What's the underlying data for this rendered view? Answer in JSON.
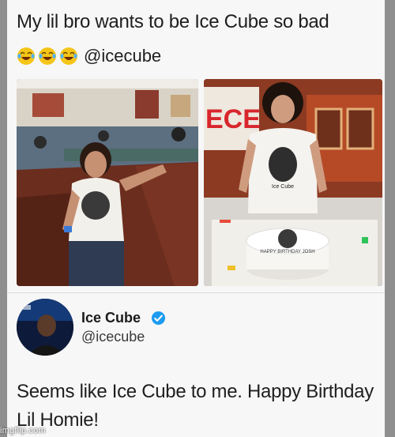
{
  "post": {
    "text": "My lil bro wants to be Ice Cube so bad",
    "emoji": [
      "laughing-crying-emoji",
      "laughing-crying-emoji",
      "laughing-crying-emoji"
    ],
    "mention": "@icecube"
  },
  "photos": {
    "left": "boy-in-restaurant-photo",
    "right": "birthday-cake-photo",
    "cake_text": "HAPPY BIRTHDAY JOSH",
    "shirt_text": "Ice Cube"
  },
  "reply": {
    "display_name": "Ice Cube",
    "handle": "@icecube",
    "verified": true,
    "text": "Seems like Ice Cube to me. Happy Birthday Lil Homie!"
  },
  "watermark": "imgflip.com",
  "colors": {
    "page_bg": "#f7f7f7",
    "frame": "#8f8f8f",
    "verified_blue": "#1d9bf0",
    "text": "#1e1e1e"
  }
}
